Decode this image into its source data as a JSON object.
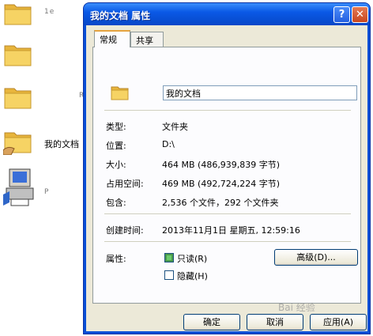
{
  "background": {
    "items": [
      {
        "label": "1e"
      },
      {
        "label": ""
      },
      {
        "label": "R"
      },
      {
        "label": "我的文档"
      },
      {
        "label": "P"
      }
    ]
  },
  "window": {
    "title": "我的文档 属性",
    "help_label": "?",
    "close_label": "✕"
  },
  "tabs": [
    {
      "label": "常规",
      "active": true
    },
    {
      "label": "共享",
      "active": false
    }
  ],
  "general": {
    "name_value": "我的文档",
    "rows": [
      {
        "label": "类型:",
        "value": "文件夹"
      },
      {
        "label": "位置:",
        "value": "D:\\"
      },
      {
        "label": "大小:",
        "value": "464 MB (486,939,839 字节)"
      },
      {
        "label": "占用空间:",
        "value": "469 MB (492,724,224 字节)"
      },
      {
        "label": "包含:",
        "value": "2,536 个文件，292 个文件夹"
      },
      {
        "label": "创建时间:",
        "value": "2013年11月1日 星期五, 12:59:16"
      },
      {
        "label": "属性:",
        "value": ""
      }
    ],
    "attributes": {
      "readonly_label": "只读(R)",
      "readonly_checked": true,
      "hidden_label": "隐藏(H)",
      "hidden_checked": false,
      "advanced_label": "高级(D)..."
    }
  },
  "buttons": {
    "ok": "确定",
    "cancel": "取消",
    "apply": "应用(A)"
  },
  "watermark": "Bai 经验",
  "colors": {
    "title_bar": "#0a59e6",
    "dialog_bg": "#ece9d8",
    "folder_yellow": "#f3c94b"
  }
}
